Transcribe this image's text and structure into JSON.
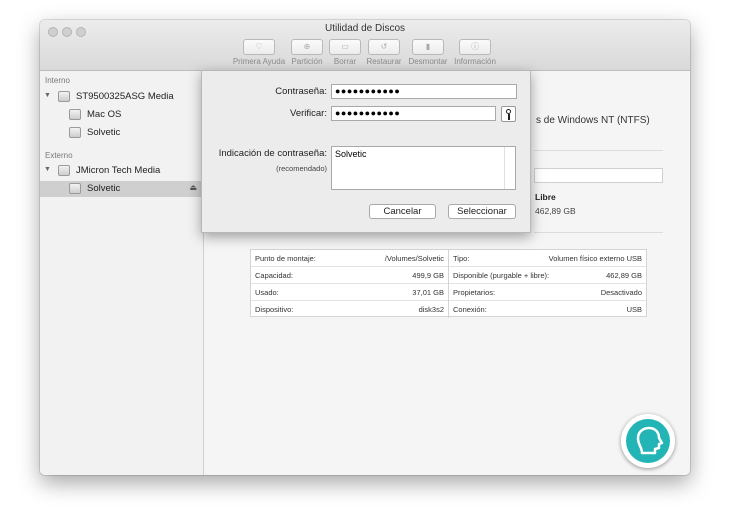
{
  "window": {
    "title": "Utilidad de Discos"
  },
  "toolbar": {
    "items": [
      {
        "label": "Primera Ayuda",
        "icon": "stethoscope-icon"
      },
      {
        "label": "Partición",
        "icon": "partition-icon"
      },
      {
        "label": "Borrar",
        "icon": "erase-icon"
      },
      {
        "label": "Restaurar",
        "icon": "restore-icon"
      },
      {
        "label": "Desmontar",
        "icon": "unmount-icon"
      },
      {
        "label": "Información",
        "icon": "info-icon"
      }
    ]
  },
  "sidebar": {
    "internal_header": "Interno",
    "external_header": "Externo",
    "items": [
      {
        "label": "ST9500325ASG Media",
        "level": 0
      },
      {
        "label": "Mac OS",
        "level": 1
      },
      {
        "label": "Solvetic",
        "level": 1
      },
      {
        "label": "JMicron Tech Media",
        "level": 0
      },
      {
        "label": "Solvetic",
        "level": 1,
        "selected": true
      }
    ],
    "eject_glyph": "⏏"
  },
  "main": {
    "format_suffix": "s de Windows NT (NTFS)",
    "free_title": "Libre",
    "free_value": "462,89 GB",
    "info_left": [
      {
        "k": "Punto de montaje:",
        "v": "/Volumes/Solvetic"
      },
      {
        "k": "Capacidad:",
        "v": "499,9 GB"
      },
      {
        "k": "Usado:",
        "v": "37,01 GB"
      },
      {
        "k": "Dispositivo:",
        "v": "disk3s2"
      }
    ],
    "info_right": [
      {
        "k": "Tipo:",
        "v": "Volumen físico externo USB"
      },
      {
        "k": "Disponible (purgable + libre):",
        "v": "462,89 GB"
      },
      {
        "k": "Propietarios:",
        "v": "Desactivado"
      },
      {
        "k": "Conexión:",
        "v": "USB"
      }
    ]
  },
  "sheet": {
    "password_label": "Contraseña:",
    "password_value": "●●●●●●●●●●●",
    "verify_label": "Verificar:",
    "verify_value": "●●●●●●●●●●●",
    "hint_label": "Indicación de contraseña:",
    "hint_sublabel": "(recomendado)",
    "hint_value": "Solvetic",
    "cancel_label": "Cancelar",
    "select_label": "Seleccionar"
  },
  "colors": {
    "logo": "#23b5b5",
    "selection": "#cfcfcf"
  }
}
